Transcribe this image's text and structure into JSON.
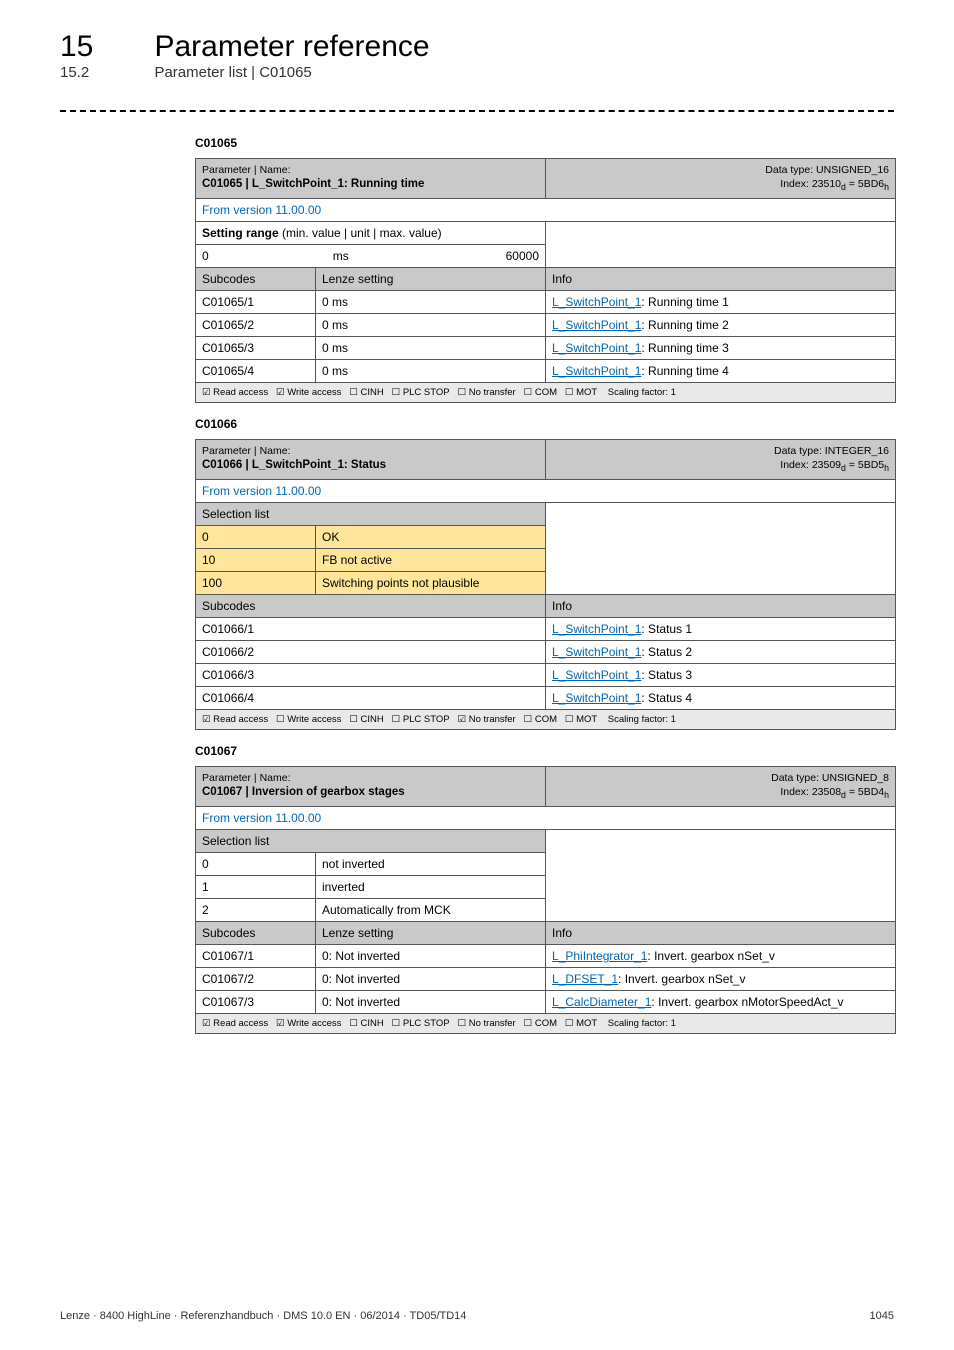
{
  "header": {
    "chapter_num": "15",
    "chapter_title": "Parameter reference",
    "section_num": "15.2",
    "section_title": "Parameter list | C01065"
  },
  "footer": {
    "left": "Lenze · 8400 HighLine · Referenzhandbuch · DMS 10.0 EN · 06/2014 · TD05/TD14",
    "page": "1045"
  },
  "read_label": "Read access",
  "write_label": "Write access",
  "cinh_label": "CINH",
  "plc_label": "PLC STOP",
  "notransfer_label": "No transfer",
  "com_label": "COM",
  "mot_label": "MOT",
  "scaling_label": "Scaling factor: 1",
  "check_on": "☑",
  "check_off": "☐",
  "t1": {
    "anchor": "C01065",
    "pname_label": "Parameter | Name:",
    "pname": "C01065 | L_SwitchPoint_1: Running time",
    "dtype": "Data type: UNSIGNED_16",
    "index": "Index: 23510",
    "index_sub_d": "d",
    "index_eq": " = 5BD6",
    "index_sub_h": "h",
    "version": "From version 11.00.00",
    "setting_range": "Setting range",
    "setting_range_sub": " (min. value | unit | max. value)",
    "min": "0",
    "unit": "ms",
    "max": "60000",
    "subcodes": "Subcodes",
    "lenze": "Lenze setting",
    "info": "Info",
    "rows": [
      {
        "sc": "C01065/1",
        "val": "0 ms",
        "lnk": "L_SwitchPoint_1",
        "tail": ": Running time 1"
      },
      {
        "sc": "C01065/2",
        "val": "0 ms",
        "lnk": "L_SwitchPoint_1",
        "tail": ": Running time 2"
      },
      {
        "sc": "C01065/3",
        "val": "0 ms",
        "lnk": "L_SwitchPoint_1",
        "tail": ": Running time 3"
      },
      {
        "sc": "C01065/4",
        "val": "0 ms",
        "lnk": "L_SwitchPoint_1",
        "tail": ": Running time 4"
      }
    ]
  },
  "t2": {
    "anchor": "C01066",
    "pname_label": "Parameter | Name:",
    "pname": "C01066 | L_SwitchPoint_1: Status",
    "dtype": "Data type: INTEGER_16",
    "index": "Index: 23509",
    "index_sub_d": "d",
    "index_eq": " = 5BD5",
    "index_sub_h": "h",
    "version": "From version 11.00.00",
    "sel_list": "Selection list",
    "opts": [
      {
        "n": "0",
        "t": "OK"
      },
      {
        "n": "10",
        "t": "FB not active"
      },
      {
        "n": "100",
        "t": "Switching points not plausible"
      }
    ],
    "subcodes": "Subcodes",
    "info": "Info",
    "rows": [
      {
        "sc": "C01066/1",
        "lnk": "L_SwitchPoint_1",
        "tail": ": Status 1"
      },
      {
        "sc": "C01066/2",
        "lnk": "L_SwitchPoint_1",
        "tail": ": Status 2"
      },
      {
        "sc": "C01066/3",
        "lnk": "L_SwitchPoint_1",
        "tail": ": Status 3"
      },
      {
        "sc": "C01066/4",
        "lnk": "L_SwitchPoint_1",
        "tail": ": Status 4"
      }
    ]
  },
  "t3": {
    "anchor": "C01067",
    "pname_label": "Parameter | Name:",
    "pname": "C01067 | Inversion of gearbox stages",
    "dtype": "Data type: UNSIGNED_8",
    "index": "Index: 23508",
    "index_sub_d": "d",
    "index_eq": " = 5BD4",
    "index_sub_h": "h",
    "version": "From version 11.00.00",
    "sel_list": "Selection list",
    "opts": [
      {
        "n": "0",
        "t": "not inverted"
      },
      {
        "n": "1",
        "t": "inverted"
      },
      {
        "n": "2",
        "t": "Automatically from MCK"
      }
    ],
    "subcodes": "Subcodes",
    "lenze": "Lenze setting",
    "info": "Info",
    "rows": [
      {
        "sc": "C01067/1",
        "val": "0: Not inverted",
        "lnk": "L_PhiIntegrator_1",
        "tail": ": Invert. gearbox nSet_v"
      },
      {
        "sc": "C01067/2",
        "val": "0: Not inverted",
        "lnk": "L_DFSET_1",
        "tail": ": Invert. gearbox nSet_v"
      },
      {
        "sc": "C01067/3",
        "val": "0: Not inverted",
        "lnk": "L_CalcDiameter_1",
        "tail": ": Invert. gearbox nMotorSpeedAct_v"
      }
    ]
  }
}
